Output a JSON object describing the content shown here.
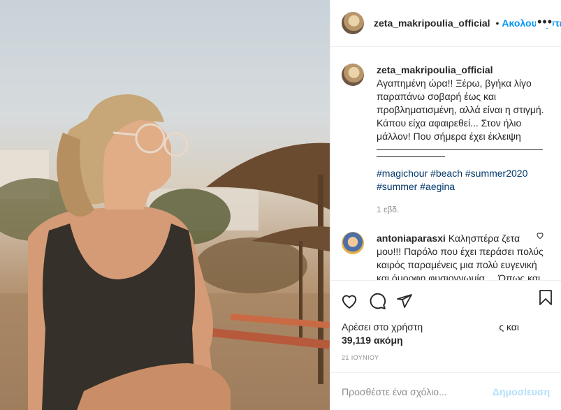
{
  "header": {
    "username": "zeta_makripoulia_official",
    "separator": "•",
    "follow_label": "Ακολουθήστε",
    "more_label": "•••"
  },
  "caption": {
    "username": "zeta_makripoulia_official",
    "text": "Αγαπημένη ώρα!! Ξέρω, βγήκα λίγο παραπάνω σοβαρή έως και προβληματισμένη, αλλά είναι η στιγμή. Κάπου είχα αφαιρεθεί... Στον ήλιο μάλλον! Που σήμερα έχει έκλειψη",
    "hashtags": [
      "#magichour",
      "#beach",
      "#summer2020",
      "#summer",
      "#aegina"
    ],
    "time": "1 εβδ."
  },
  "comment": {
    "username": "antoniaparasxi",
    "text": "Καλησπέρα ζετα μου!!! Παρόλο που έχει περάσει πολύς καιρός παραμένεις μια πολύ ευγενική και όμορφη φυσιογνωμία.... Όπως και τότε στα σχολικά μας χρόνια!!!"
  },
  "icons": {
    "like": "heart-icon",
    "comment": "comment-icon",
    "share": "share-icon",
    "save": "bookmark-icon"
  },
  "likes": {
    "line1": "Αρέσει στο χρήστη",
    "tail": "ς και",
    "line2": "39,119 ακόμη"
  },
  "date": "21 ΙΟΥΝΙΟΥ",
  "add_comment": {
    "placeholder": "Προσθέστε ένα σχόλιο...",
    "post_label": "Δημοσίευση"
  }
}
